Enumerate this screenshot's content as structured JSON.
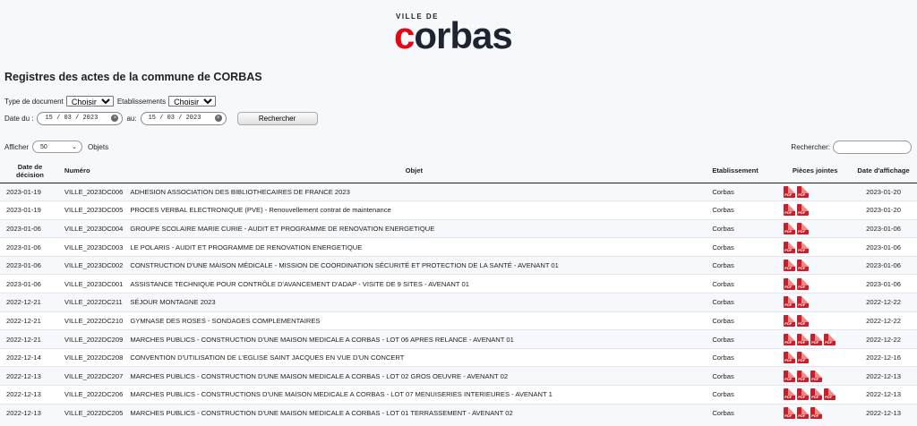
{
  "logo": {
    "ville": "VILLE DE",
    "c": "c",
    "rest": "orbas"
  },
  "page_title": "Registres des actes de la commune de CORBAS",
  "filters": {
    "type_label": "Type de document",
    "type_value": "Choisir",
    "etab_label": "Etablissements",
    "etab_value": "Choisir",
    "date_from_label": "Date du :",
    "date_from_value": "15 / 03 / 2023",
    "date_to_label": "au:",
    "date_to_value": "15 / 03 / 2023",
    "search_button": "Rechercher"
  },
  "length": {
    "label_before": "Afficher",
    "value": "50",
    "label_after": "Objets"
  },
  "search": {
    "label": "Rechercher:"
  },
  "table": {
    "headers": {
      "date_decision": "Date de décision",
      "numero": "Numéro",
      "objet": "Objet",
      "etablissement": "Etablissement",
      "pieces": "Pièces jointes",
      "date_affichage": "Date d'affichage"
    },
    "rows": [
      {
        "date": "2023-01-19",
        "num": "VILLE_2023DC006",
        "objet": "ADHESION ASSOCIATION DES BIBLIOTHECAIRES DE FRANCE 2023",
        "etab": "Corbas",
        "pj": 2,
        "aff": "2023-01-20"
      },
      {
        "date": "2023-01-19",
        "num": "VILLE_2023DC005",
        "objet": "PROCES VERBAL ELECTRONIQUE (PVE) - Renouvellement contrat de maintenance",
        "etab": "Corbas",
        "pj": 2,
        "aff": "2023-01-20"
      },
      {
        "date": "2023-01-06",
        "num": "VILLE_2023DC004",
        "objet": "GROUPE SCOLAIRE MARIE CURIE - AUDIT ET PROGRAMME DE RENOVATION ENERGETIQUE",
        "etab": "Corbas",
        "pj": 2,
        "aff": "2023-01-06"
      },
      {
        "date": "2023-01-06",
        "num": "VILLE_2023DC003",
        "objet": "LE POLARIS - AUDIT ET PROGRAMME DE RENOVATION ENERGETIQUE",
        "etab": "Corbas",
        "pj": 2,
        "aff": "2023-01-06"
      },
      {
        "date": "2023-01-06",
        "num": "VILLE_2023DC002",
        "objet": "CONSTRUCTION D'UNE MAISON MÉDICALE - MISSION DE COORDINATION SÉCURITÉ ET PROTECTION DE LA SANTÉ - AVENANT 01",
        "etab": "Corbas",
        "pj": 2,
        "aff": "2023-01-06"
      },
      {
        "date": "2023-01-06",
        "num": "VILLE_2023DC001",
        "objet": "ASSISTANCE TECHNIQUE POUR CONTRÔLE D'AVANCEMENT D'ADAP - VISITE DE 9 SITES - AVENANT 01",
        "etab": "Corbas",
        "pj": 2,
        "aff": "2023-01-06"
      },
      {
        "date": "2022-12-21",
        "num": "VILLE_2022DC211",
        "objet": "SÉJOUR MONTAGNE 2023",
        "etab": "Corbas",
        "pj": 2,
        "aff": "2022-12-22"
      },
      {
        "date": "2022-12-21",
        "num": "VILLE_2022DC210",
        "objet": "GYMNASE DES ROSES - SONDAGES COMPLEMENTAIRES",
        "etab": "Corbas",
        "pj": 2,
        "aff": "2022-12-22"
      },
      {
        "date": "2022-12-21",
        "num": "VILLE_2022DC209",
        "objet": "MARCHES PUBLICS - CONSTRUCTION D'UNE MAISON MEDICALE A CORBAS - LOT 06 APRES RELANCE - AVENANT 01",
        "etab": "Corbas",
        "pj": 4,
        "aff": "2022-12-22"
      },
      {
        "date": "2022-12-14",
        "num": "VILLE_2022DC208",
        "objet": "CONVENTION D'UTILISATION DE L'EGLISE SAINT JACQUES EN VUE D'UN CONCERT",
        "etab": "Corbas",
        "pj": 2,
        "aff": "2022-12-16"
      },
      {
        "date": "2022-12-13",
        "num": "VILLE_2022DC207",
        "objet": "MARCHES PUBLICS - CONSTRUCTION D'UNE MAISON MEDICALE A CORBAS - LOT 02 GROS OEUVRE - AVENANT 02",
        "etab": "Corbas",
        "pj": 3,
        "aff": "2022-12-13"
      },
      {
        "date": "2022-12-13",
        "num": "VILLE_2022DC206",
        "objet": "MARCHES PUBLICS - CONSTRUCTIONS D'UNE MAISON MEDICALE A CORBAS - LOT 07 MENUISERIES INTERIEURES - AVENANT 1",
        "etab": "Corbas",
        "pj": 4,
        "aff": "2022-12-13"
      },
      {
        "date": "2022-12-13",
        "num": "VILLE_2022DC205",
        "objet": "MARCHES PUBLICS - CONSTRUCTION D'UNE MAISON MEDICALE A CORBAS - LOT 01 TERRASSEMENT - AVENANT 02",
        "etab": "Corbas",
        "pj": 3,
        "aff": "2022-12-13"
      }
    ]
  }
}
